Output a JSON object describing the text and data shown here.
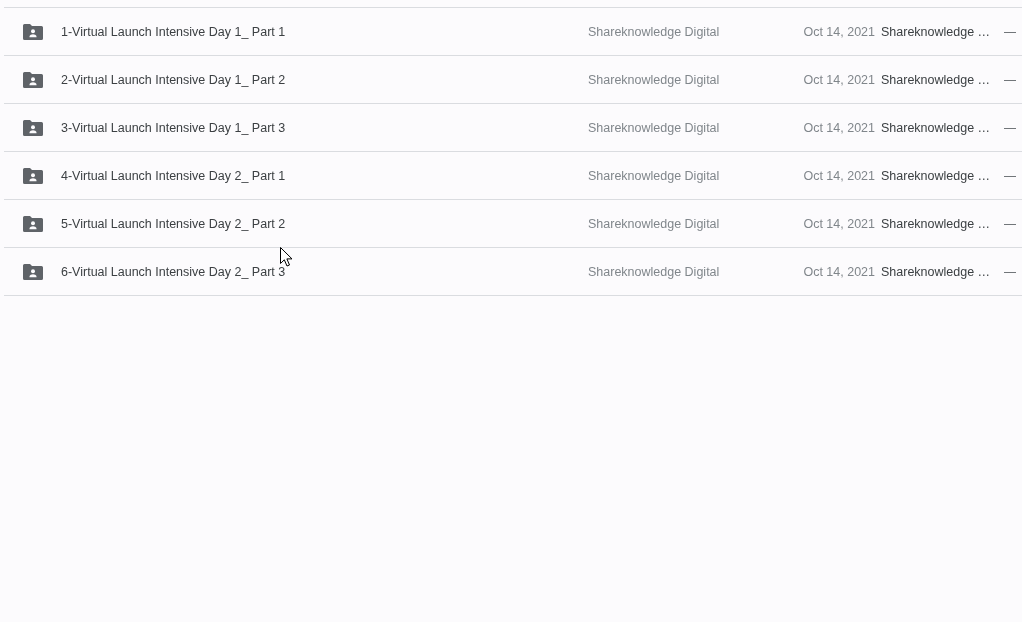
{
  "file_list": {
    "rows": [
      {
        "name": "1-Virtual Launch Intensive Day 1_ Part 1",
        "column_2": "Shareknowledge Digital",
        "column_3": "Oct 14, 2021",
        "column_4": "Shareknowledge …",
        "column_5": "—"
      },
      {
        "name": "2-Virtual Launch Intensive Day 1_ Part 2",
        "column_2": "Shareknowledge Digital",
        "column_3": "Oct 14, 2021",
        "column_4": "Shareknowledge …",
        "column_5": "—"
      },
      {
        "name": "3-Virtual Launch Intensive Day 1_ Part 3",
        "column_2": "Shareknowledge Digital",
        "column_3": "Oct 14, 2021",
        "column_4": "Shareknowledge …",
        "column_5": "—"
      },
      {
        "name": "4-Virtual Launch Intensive Day 2_ Part 1",
        "column_2": "Shareknowledge Digital",
        "column_3": "Oct 14, 2021",
        "column_4": "Shareknowledge …",
        "column_5": "—"
      },
      {
        "name": "5-Virtual Launch Intensive Day 2_ Part 2",
        "column_2": "Shareknowledge Digital",
        "column_3": "Oct 14, 2021",
        "column_4": "Shareknowledge …",
        "column_5": "—"
      },
      {
        "name": "6-Virtual Launch Intensive Day 2_ Part 3",
        "column_2": "Shareknowledge Digital",
        "column_3": "Oct 14, 2021",
        "column_4": "Shareknowledge …",
        "column_5": "—"
      }
    ]
  }
}
